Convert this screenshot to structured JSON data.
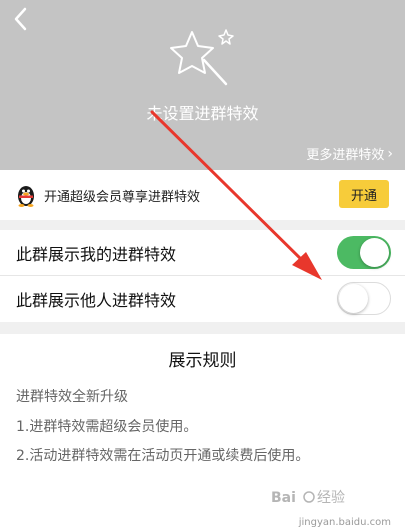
{
  "header": {
    "back_icon": "chevron-left-icon",
    "title": "未设置进群特效",
    "more_link": "更多进群特效"
  },
  "vip_banner": {
    "icon": "qq-penguin-icon",
    "text": "开通超级会员尊享进群特效",
    "button_label": "开通",
    "button_color": "#f7cc3a"
  },
  "settings": [
    {
      "label": "此群展示我的进群特效",
      "enabled": true
    },
    {
      "label": "此群展示他人进群特效",
      "enabled": false
    }
  ],
  "rules": {
    "title": "展示规则",
    "lines": [
      "进群特效全新升级",
      "1.进群特效需超级会员使用。",
      "2.活动进群特效需在活动页开通或续费后使用。"
    ]
  },
  "colors": {
    "toggle_on": "#4cba63",
    "annotation_arrow": "#e8372c",
    "hero_background": "#c4c4c4"
  },
  "watermark": {
    "logo": "Baidu 经验",
    "url": "jingyan.baidu.com"
  }
}
